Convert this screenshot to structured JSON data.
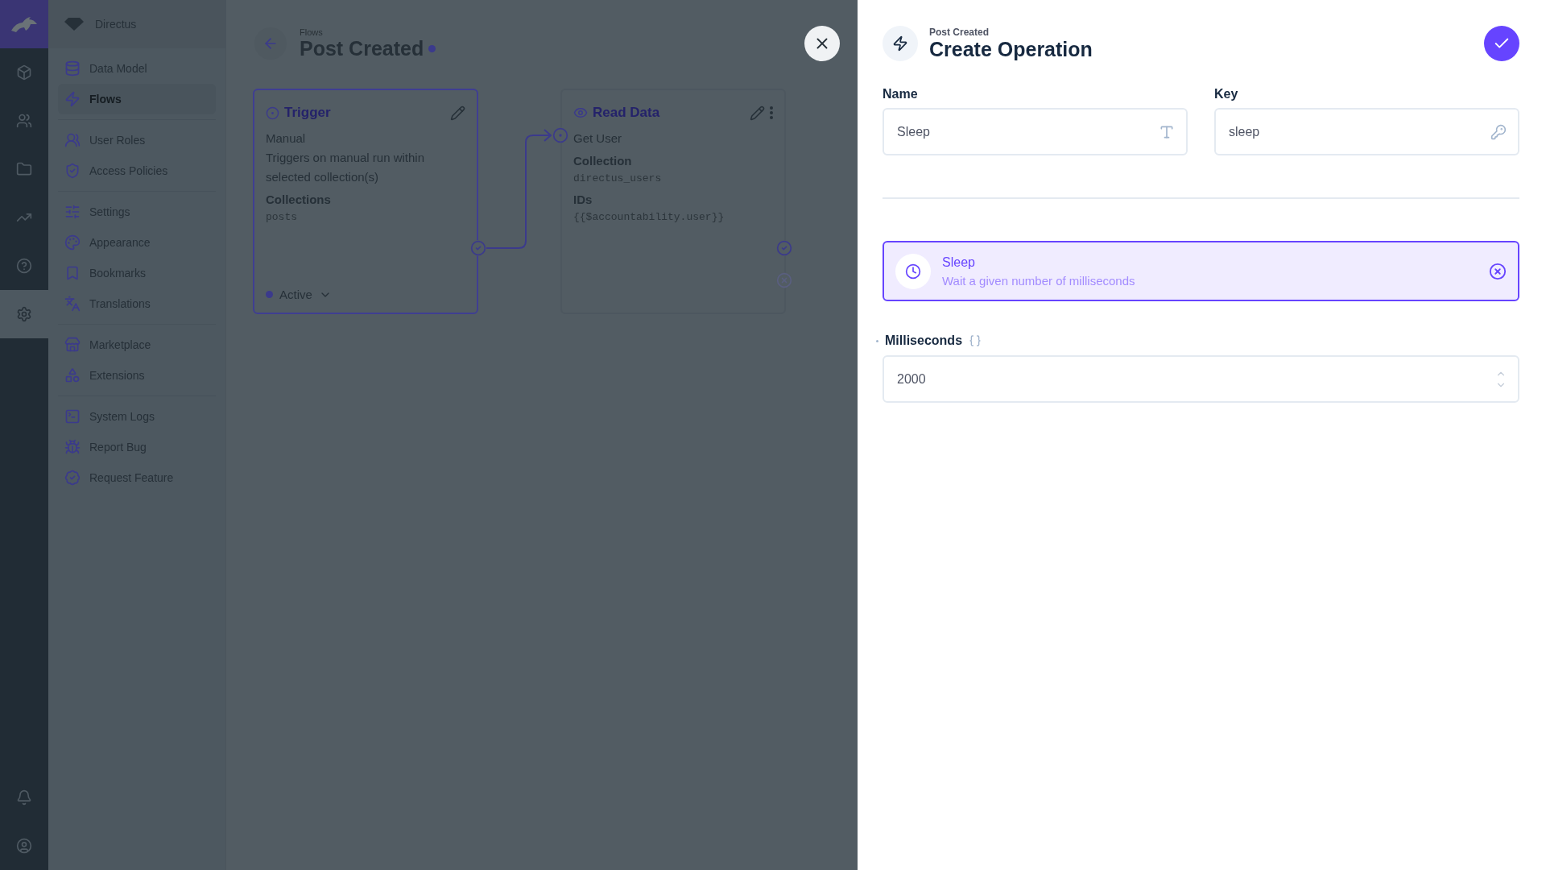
{
  "module_bar": {
    "modules": [
      {
        "selected": false
      },
      {
        "selected": false
      },
      {
        "selected": false
      },
      {
        "selected": false
      },
      {
        "selected": false
      },
      {
        "selected": true
      }
    ],
    "bottom": [
      {
        "selected": false
      },
      {
        "selected": false
      }
    ]
  },
  "sidebar": {
    "project": "Directus",
    "groups": [
      {
        "items": [
          {
            "label": "Data Model",
            "selected": false
          },
          {
            "label": "Flows",
            "selected": true
          }
        ]
      },
      {
        "items": [
          {
            "label": "User Roles",
            "selected": false
          },
          {
            "label": "Access Policies",
            "selected": false
          }
        ]
      },
      {
        "items": [
          {
            "label": "Settings",
            "selected": false
          },
          {
            "label": "Appearance",
            "selected": false
          },
          {
            "label": "Bookmarks",
            "selected": false
          },
          {
            "label": "Translations",
            "selected": false
          }
        ]
      },
      {
        "items": [
          {
            "label": "Marketplace",
            "selected": false
          },
          {
            "label": "Extensions",
            "selected": false
          }
        ]
      },
      {
        "items": [
          {
            "label": "System Logs",
            "selected": false
          },
          {
            "label": "Report Bug",
            "selected": false
          },
          {
            "label": "Request Feature",
            "selected": false
          }
        ]
      }
    ]
  },
  "header": {
    "breadcrumb": "Flows",
    "title": "Post Created",
    "edited": true
  },
  "flow": {
    "trigger": {
      "title": "Trigger",
      "selected": true,
      "type": "Manual",
      "description": "Triggers on manual run within selected collection(s)",
      "fields": [
        {
          "label": "Collections",
          "value": "posts"
        }
      ],
      "status": "Active"
    },
    "operation": {
      "title": "Read Data",
      "selected": false,
      "name": "Get User",
      "fields": [
        {
          "label": "Collection",
          "value": "directus_users"
        },
        {
          "label": "IDs",
          "value": "{{$accountability.user}}"
        }
      ]
    }
  },
  "drawer": {
    "breadcrumb": "Post Created",
    "title": "Create Operation",
    "name": {
      "label": "Name",
      "value": "Sleep"
    },
    "key": {
      "label": "Key",
      "value": "sleep"
    },
    "selected_operation": {
      "title": "Sleep",
      "description": "Wait a given number of milliseconds"
    },
    "option": {
      "label": "Milliseconds",
      "required": true,
      "value": "2000"
    }
  }
}
